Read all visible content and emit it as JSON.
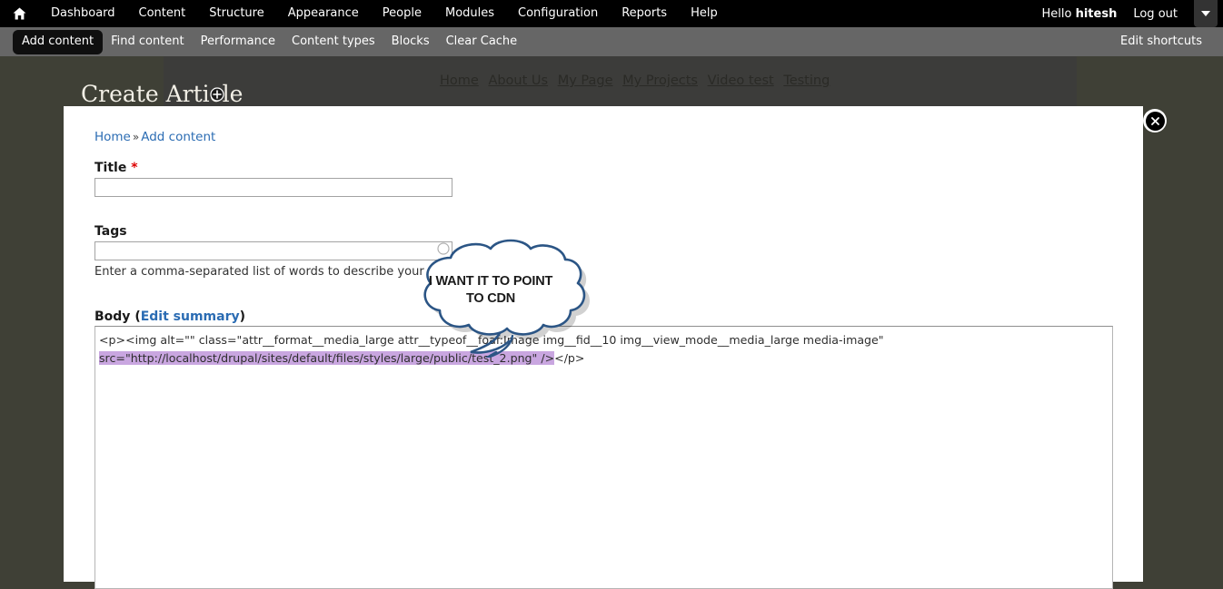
{
  "admin_bar": {
    "home_icon": "home-icon",
    "menu": [
      {
        "label": "Dashboard"
      },
      {
        "label": "Content"
      },
      {
        "label": "Structure"
      },
      {
        "label": "Appearance"
      },
      {
        "label": "People"
      },
      {
        "label": "Modules"
      },
      {
        "label": "Configuration"
      },
      {
        "label": "Reports"
      },
      {
        "label": "Help"
      }
    ],
    "greeting_prefix": "Hello ",
    "username": "hitesh",
    "logout_label": "Log out",
    "toggle_icon": "chevron-down-icon"
  },
  "shortcut_bar": {
    "items": [
      {
        "label": "Add content",
        "active": true
      },
      {
        "label": "Find content",
        "active": false
      },
      {
        "label": "Performance",
        "active": false
      },
      {
        "label": "Content types",
        "active": false
      },
      {
        "label": "Blocks",
        "active": false
      },
      {
        "label": "Clear Cache",
        "active": false
      }
    ],
    "edit_label": "Edit shortcuts"
  },
  "site_header": {
    "page_title": "Create Article",
    "add_icon": "plus-circle-icon",
    "primary_menu": [
      {
        "label": "Home"
      },
      {
        "label": "About Us"
      },
      {
        "label": "My Page"
      },
      {
        "label": "My Projects"
      },
      {
        "label": "Video test"
      },
      {
        "label": "Testing"
      }
    ]
  },
  "overlay": {
    "close_icon": "close-icon",
    "breadcrumb": {
      "home": "Home",
      "separator": "»",
      "current": "Add content"
    },
    "form": {
      "title_field": {
        "label": "Title",
        "required_mark": "*",
        "value": "",
        "placeholder": ""
      },
      "tags_field": {
        "label": "Tags",
        "value": "",
        "placeholder": "",
        "description": "Enter a comma-separated list of words to describe your content."
      },
      "body_field": {
        "label": "Body",
        "edit_summary_link": "Edit summary",
        "open_paren": "(",
        "close_paren": ")",
        "line1": "<p><img alt=\"\" class=\"attr__format__media_large attr__typeof__foaf:Image img__fid__10 img__view_mode__media_large media-image\"",
        "line2_selected": "src=\"http://localhost/drupal/sites/default/files/styles/large/public/test_2.png\" />",
        "line2_tail": "</p>"
      }
    }
  },
  "annotation": {
    "bubble_text_line1": "I WANT IT TO POINT",
    "bubble_text_line2": "TO CDN",
    "bubble_outline_color": "#2b5585",
    "bubble_fill_color": "#ffffff"
  },
  "colors": {
    "page_background": "#3f4036",
    "admin_bar": "#000000",
    "shortcut_bar": "#666666",
    "link_blue": "#2b6cb3",
    "required_red": "#dd0000",
    "selection_purple": "#c9a6e0"
  }
}
